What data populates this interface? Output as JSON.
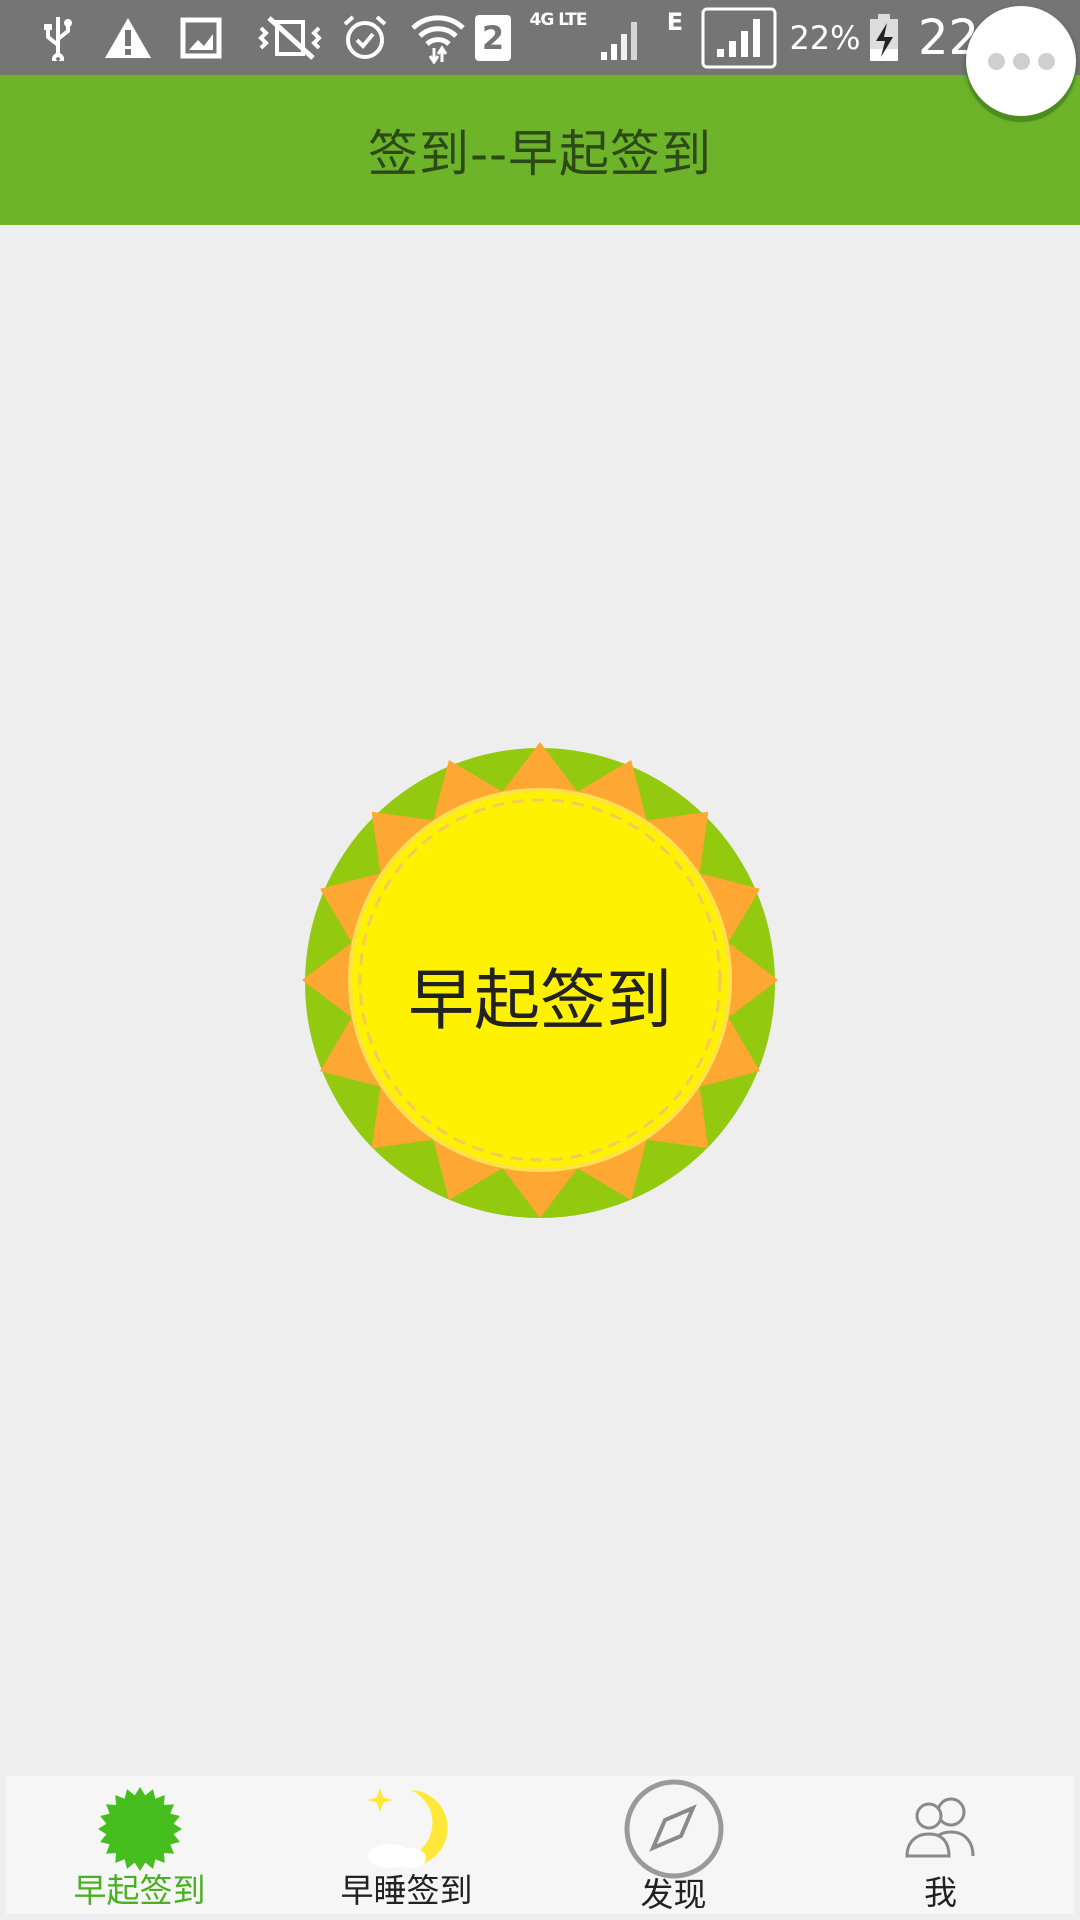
{
  "status_bar": {
    "network_type": "4G LTE",
    "sim_slot": "2",
    "edge_label": "E",
    "battery_percent": "22%",
    "time": "22",
    "icons": [
      "usb-icon",
      "warning-icon",
      "image-icon",
      "vibrate-off-icon",
      "alarm-icon",
      "wifi-icon",
      "sim-2-icon",
      "signal-icon",
      "edge-icon",
      "signal-box-icon",
      "battery-charging-icon"
    ]
  },
  "header": {
    "title": "签到--早起签到"
  },
  "main": {
    "checkin_button_label": "早起签到"
  },
  "tabs": [
    {
      "label": "早起签到",
      "icon": "sun-badge-icon",
      "active": true
    },
    {
      "label": "早睡签到",
      "icon": "moon-icon",
      "active": false
    },
    {
      "label": "发现",
      "icon": "compass-icon",
      "active": false
    },
    {
      "label": "我",
      "icon": "users-icon",
      "active": false
    }
  ],
  "colors": {
    "header_bg": "#6db42b",
    "status_bg": "#757575",
    "accent_green": "#4ab020",
    "sun_yellow": "#fff200",
    "sun_orange": "#ffa733",
    "sun_green_ring": "#93c90e"
  }
}
